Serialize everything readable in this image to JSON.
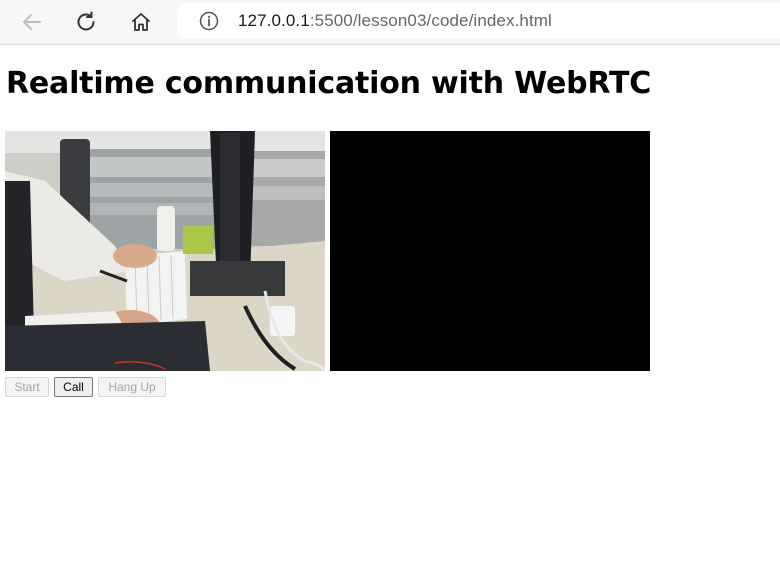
{
  "browser": {
    "url_host": "127.0.0.1",
    "url_rest": ":5500/lesson03/code/index.html"
  },
  "page": {
    "title": "Realtime communication with WebRTC"
  },
  "videos": {
    "local": {
      "content": "webcam-feed"
    },
    "remote": {
      "content": "black"
    }
  },
  "controls": {
    "start_label": "Start",
    "call_label": "Call",
    "hangup_label": "Hang Up",
    "start_enabled": false,
    "call_enabled": true,
    "hangup_enabled": false
  },
  "colors": {
    "toolbar_bg": "#f7f7f7",
    "remote_video_bg": "#000000",
    "disabled_text": "#a6a6a6"
  }
}
